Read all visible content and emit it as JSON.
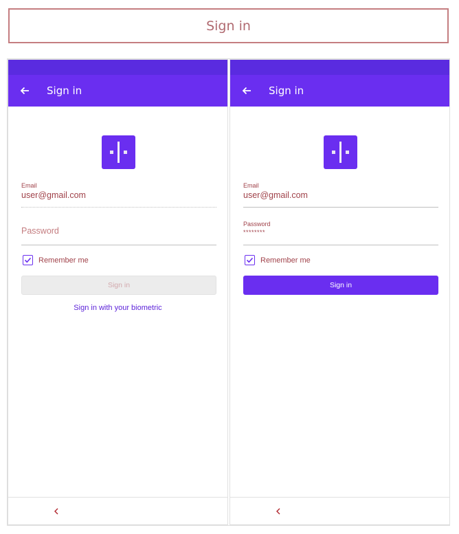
{
  "banner": {
    "title": "Sign in"
  },
  "screens": [
    {
      "appbar": {
        "title": "Sign in"
      },
      "email": {
        "label": "Email",
        "value": "user@gmail.com"
      },
      "password": {
        "label": "",
        "placeholder": "Password",
        "value": ""
      },
      "remember": {
        "label": "Remember me",
        "checked": true
      },
      "button": {
        "label": "Sign in",
        "state": "disabled"
      },
      "biometric": {
        "label": "Sign in with your biometric"
      }
    },
    {
      "appbar": {
        "title": "Sign in"
      },
      "email": {
        "label": "Email",
        "value": "user@gmail.com"
      },
      "password": {
        "label": "Password",
        "placeholder": "",
        "value": "********"
      },
      "remember": {
        "label": "Remember me",
        "checked": true
      },
      "button": {
        "label": "Sign in",
        "state": "enabled"
      }
    }
  ],
  "colors": {
    "primary": "#6a2ef0",
    "status_bar": "#5a2be0",
    "text_accent": "#a0424a",
    "disabled_button": "#ececec"
  },
  "icons": [
    "back-arrow-icon",
    "app-logo-icon",
    "checkbox-checked-icon",
    "nav-back-icon"
  ]
}
